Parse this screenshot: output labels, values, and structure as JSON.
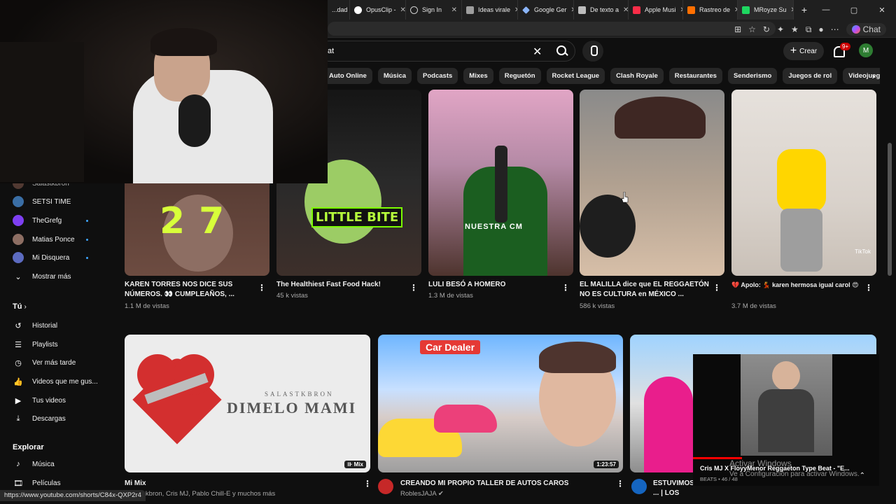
{
  "browser": {
    "tabs": [
      {
        "label": "...dad ",
        "color": "#888888"
      },
      {
        "label": "OpusClip -",
        "color": "#ffffff"
      },
      {
        "label": "Sign In",
        "color": "#cfcfcf"
      },
      {
        "label": "Ideas virale",
        "color": "#9e9e9e"
      },
      {
        "label": "Google Ger",
        "color": "#8ab4f8"
      },
      {
        "label": "De texto a",
        "color": "#bdbdbd"
      },
      {
        "label": "Apple Musi",
        "color": "#fa2d48"
      },
      {
        "label": "Rastreo de",
        "color": "#ff6f00"
      },
      {
        "label": "MRoyze Su",
        "color": "#1ed760"
      }
    ],
    "new_tab": "+",
    "copilot_label": "Chat"
  },
  "youtube": {
    "search_value": "at",
    "create_label": "Crear",
    "notifications_badge": "9+",
    "avatar_letter": "M",
    "chips": [
      "Auto Online",
      "Música",
      "Podcasts",
      "Mixes",
      "Reguetón",
      "Rocket League",
      "Clash Royale",
      "Restaurantes",
      "Senderismo",
      "Juegos de rol",
      "Videojuegos de"
    ]
  },
  "sidebar": {
    "subs_partial": "Salastkbron",
    "subs": [
      {
        "label": "SETSI TIME",
        "color": "#3a6ea5",
        "live": false
      },
      {
        "label": "TheGrefg",
        "color": "#7e3ff2",
        "live": true
      },
      {
        "label": "Matias Ponce",
        "color": "#8d6e63",
        "live": true
      },
      {
        "label": "Mi Disquera",
        "color": "#5c6bc0",
        "live": true
      }
    ],
    "show_more": "Mostrar más",
    "you_header": "Tú",
    "you_items": [
      "Historial",
      "Playlists",
      "Ver más tarde",
      "Videos que me gus...",
      "Tus videos",
      "Descargas"
    ],
    "explore_header": "Explorar",
    "explore_items": [
      "Música",
      "Películas"
    ]
  },
  "shorts": [
    {
      "title": "KAREN TORRES NOS DICE SUS NÚMEROS. 👀 CUMPLEAÑOS, ...",
      "views": "1.1 M de vistas",
      "overlay": "27"
    },
    {
      "title": "The Healthiest Fast Food Hack!",
      "views": "45 k vistas",
      "overlay": "LITTLE BITE"
    },
    {
      "title": "LULI BESÓ A HOMERO",
      "views": "1.3 M de vistas",
      "overlay": "NUESTRA CM"
    },
    {
      "title": "EL MALILLA dice que EL REGGAETÓN NO ES CULTURA en MÉXICO ...",
      "views": "586 k vistas",
      "overlay": ""
    },
    {
      "title": "💔 Apolo: 💃 karen hermosa igual carol 😍",
      "views": "3.7 M de vistas",
      "overlay": "TikTok"
    }
  ],
  "videos": [
    {
      "title": "Mi Mix",
      "meta": "...kbron, Cris MJ, Pablo Chill-E y muchos más",
      "badge": "Mix",
      "artist": "SALASTKBRON",
      "thumb_text": "DIMELO MAMI"
    },
    {
      "title": "CREANDO MI PROPIO TALLER DE AUTOS CAROS",
      "channel": "RoblesJAJA",
      "duration": "1:23:57",
      "thumb_text": "Car Dealer"
    },
    {
      "title": "ESTUVIMOS ... | LOS POLINESIOS",
      "channel": ""
    }
  ],
  "miniplayer": {
    "title": "Cris MJ X FloyyMenor Reggaeton Type Beat - \"E...",
    "meta": "BEATS • 46 / 48"
  },
  "windows_watermark": {
    "line1": "Activar Windows",
    "line2": "Ve a Configuración para activar Windows."
  },
  "status_url": "https://www.youtube.com/shorts/C84x-QXP2r4"
}
